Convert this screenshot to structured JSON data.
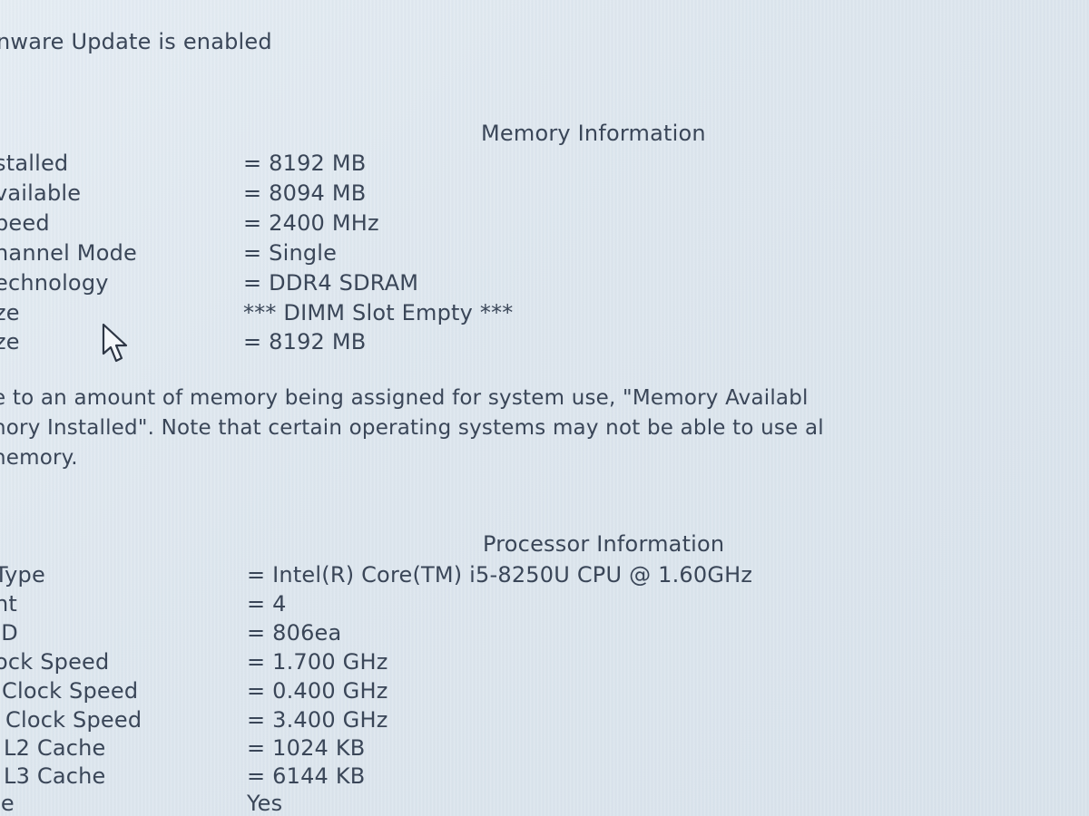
{
  "status": {
    "firmware_update": "nware Update is enabled"
  },
  "memory": {
    "heading": "Memory Information",
    "rows": [
      {
        "label": "stalled",
        "value": "= 8192 MB"
      },
      {
        "label": "vailable",
        "value": "= 8094 MB"
      },
      {
        "label": "peed",
        "value": "= 2400 MHz"
      },
      {
        "label": "hannel Mode",
        "value": "= Single"
      },
      {
        "label": "echnology",
        "value": "= DDR4 SDRAM"
      },
      {
        "label": "ze",
        "value": "*** DIMM Slot Empty ***"
      },
      {
        "label": "ze",
        "value": "= 8192 MB"
      }
    ],
    "note_lines": [
      "e to an amount of memory being assigned for system use, \"Memory Availabl",
      "nory Installed\". Note that certain operating systems may not be able to use al",
      "nemory."
    ]
  },
  "processor": {
    "heading": "Processor Information",
    "rows": [
      {
        "label": "Type",
        "value": "= Intel(R) Core(TM) i5-8250U CPU @ 1.60GHz"
      },
      {
        "label": "nt",
        "value": "= 4"
      },
      {
        "label": "ID",
        "value": "= 806ea"
      },
      {
        "label": "ock Speed",
        "value": "= 1.700 GHz"
      },
      {
        "label": "Clock Speed",
        "value": "= 0.400 GHz"
      },
      {
        "label": "Clock Speed",
        "value": "= 3.400 GHz"
      },
      {
        "label": "L2 Cache",
        "value": "= 1024 KB"
      },
      {
        "label": "L3 Cache",
        "value": "= 6144 KB"
      },
      {
        "label": "le",
        "value": "Yes"
      }
    ]
  }
}
